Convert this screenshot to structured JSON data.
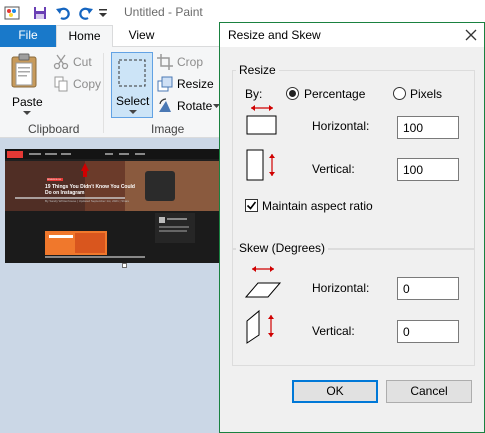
{
  "app": {
    "title": "Untitled - Paint"
  },
  "tabs": [
    {
      "label": "File"
    },
    {
      "label": "Home"
    },
    {
      "label": "View"
    }
  ],
  "ribbon": {
    "clipboard": {
      "group_label": "Clipboard",
      "paste": "Paste",
      "cut": "Cut",
      "copy": "Copy"
    },
    "image": {
      "group_label": "Image",
      "select": "Select",
      "crop": "Crop",
      "resize": "Resize",
      "rotate": "Rotate"
    }
  },
  "canvas": {
    "thumbnail": {
      "badge": "REVIEW BLOG",
      "headline_line1": "19 Things You Didn't Know You Could",
      "headline_line2": "Do on Instagram",
      "byline": "By Sandy Writtenhouse | Updated September 1st, 2021 | Share"
    }
  },
  "dialog": {
    "title": "Resize and Skew",
    "resize": {
      "legend": "Resize",
      "by_label": "By:",
      "percentage_label": "Percentage",
      "pixels_label": "Pixels",
      "selected_unit": "Percentage",
      "horizontal_label": "Horizontal:",
      "horizontal_value": "100",
      "vertical_label": "Vertical:",
      "vertical_value": "100",
      "maintain_label": "Maintain aspect ratio",
      "maintain_checked": true
    },
    "skew": {
      "legend": "Skew (Degrees)",
      "horizontal_label": "Horizontal:",
      "horizontal_value": "0",
      "vertical_label": "Vertical:",
      "vertical_value": "0"
    },
    "ok_label": "OK",
    "cancel_label": "Cancel"
  },
  "colors": {
    "file_tab": "#1979ca",
    "dialog_border": "#1a8140",
    "select_highlight": "#cce4f7",
    "arrow_red": "#d00000"
  },
  "icons": [
    "paint-app-icon",
    "save-icon",
    "undo-icon",
    "redo-icon",
    "customize-qat-icon",
    "paste-icon",
    "cut-icon",
    "copy-icon",
    "select-icon",
    "crop-icon",
    "resize-icon",
    "rotate-icon",
    "close-icon"
  ]
}
